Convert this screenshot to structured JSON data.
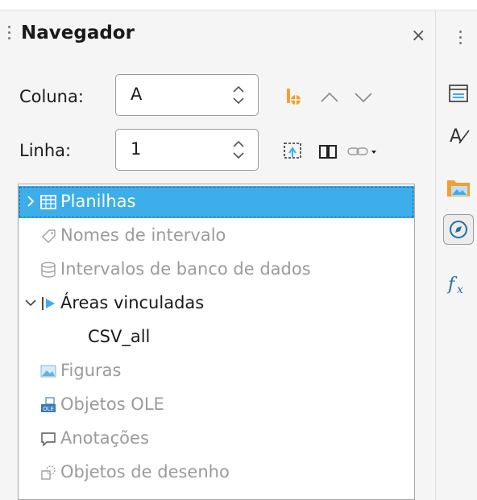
{
  "navigator": {
    "title": "Navegador",
    "column_label": "Coluna:",
    "column_value": "A",
    "row_label": "Linha:",
    "row_value": "1"
  },
  "tree": [
    {
      "label": "Planilhas",
      "icon": "table-icon",
      "state": "selected",
      "expander": "collapsed"
    },
    {
      "label": "Nomes de intervalo",
      "icon": "tag-icon",
      "state": "disabled"
    },
    {
      "label": "Intervalos de banco de dados",
      "icon": "database-icon",
      "state": "disabled"
    },
    {
      "label": "Áreas vinculadas",
      "icon": "linked-area-icon",
      "state": "normal",
      "expander": "expanded"
    },
    {
      "label": "CSV_all",
      "state": "normal",
      "child": true
    },
    {
      "label": "Figuras",
      "icon": "image-icon",
      "state": "disabled"
    },
    {
      "label": "Objetos OLE",
      "icon": "ole-icon",
      "state": "disabled"
    },
    {
      "label": "Anotações",
      "icon": "comment-icon",
      "state": "disabled"
    },
    {
      "label": "Objetos de desenho",
      "icon": "drawing-icon",
      "state": "disabled"
    }
  ],
  "colors": {
    "selection": "#3daee9",
    "accent": "#f0a030",
    "disabled_text": "#9b9b9b"
  }
}
